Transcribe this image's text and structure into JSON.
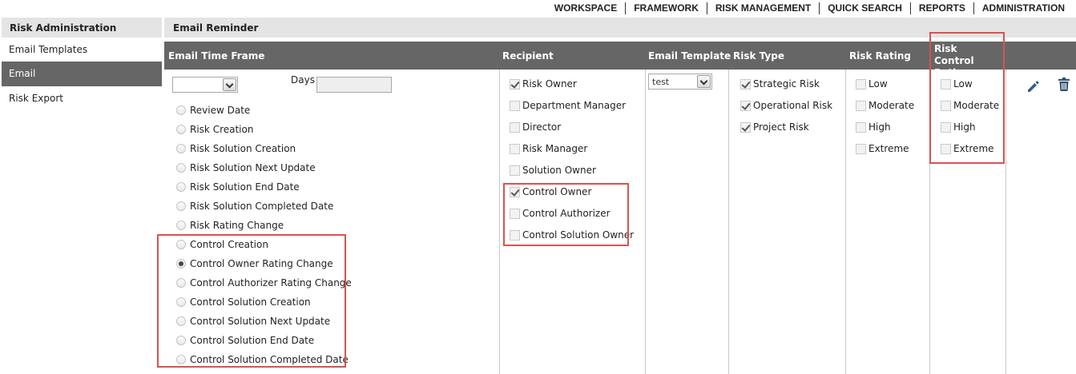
{
  "topnav": {
    "items": [
      "WORKSPACE",
      "FRAMEWORK",
      "RISK MANAGEMENT",
      "QUICK SEARCH",
      "REPORTS",
      "ADMINISTRATION"
    ]
  },
  "sidebar": {
    "title": "Risk Administration",
    "items": [
      "Email Templates",
      "Email",
      "Risk Export"
    ],
    "active": "Email"
  },
  "main": {
    "title": "Email Reminder",
    "columns": {
      "time_frame": "Email Time Frame",
      "recipient": "Recipient",
      "template": "Email Template",
      "risk_type": "Risk Type",
      "risk_rating": "Risk Rating",
      "control_rating": "Risk Control Rating"
    },
    "time_frame_select": "",
    "days_label": "Days",
    "days_value": "",
    "time_frame_options": [
      "Review Date",
      "Risk Creation",
      "Risk Solution Creation",
      "Risk Solution Next Update",
      "Risk Solution End Date",
      "Risk Solution Completed Date",
      "Risk Rating Change",
      "Control Creation",
      "Control Owner Rating Change",
      "Control Authorizer Rating Change",
      "Control Solution Creation",
      "Control Solution Next Update",
      "Control Solution End Date",
      "Control Solution Completed Date"
    ],
    "time_frame_selected": "Control Owner Rating Change",
    "recipients": [
      {
        "label": "Risk Owner",
        "checked": true
      },
      {
        "label": "Department Manager",
        "checked": false
      },
      {
        "label": "Director",
        "checked": false
      },
      {
        "label": "Risk Manager",
        "checked": false
      },
      {
        "label": "Solution Owner",
        "checked": false
      },
      {
        "label": "Control Owner",
        "checked": true
      },
      {
        "label": "Control Authorizer",
        "checked": false
      },
      {
        "label": "Control Solution Owner",
        "checked": false
      }
    ],
    "template_value": "test",
    "risk_types": [
      {
        "label": "Strategic Risk",
        "checked": true
      },
      {
        "label": "Operational Risk",
        "checked": true
      },
      {
        "label": "Project Risk",
        "checked": true
      }
    ],
    "risk_ratings": [
      {
        "label": "Low",
        "checked": false
      },
      {
        "label": "Moderate",
        "checked": false
      },
      {
        "label": "High",
        "checked": false
      },
      {
        "label": "Extreme",
        "checked": false
      }
    ],
    "control_ratings": [
      {
        "label": "Low",
        "checked": false
      },
      {
        "label": "Moderate",
        "checked": false
      },
      {
        "label": "High",
        "checked": false
      },
      {
        "label": "Extreme",
        "checked": false
      }
    ],
    "actions": {
      "edit_icon": "pencil-icon",
      "delete_icon": "trash-icon"
    },
    "colors": {
      "header_bar": "#666666",
      "highlight": "#d9534f"
    }
  }
}
